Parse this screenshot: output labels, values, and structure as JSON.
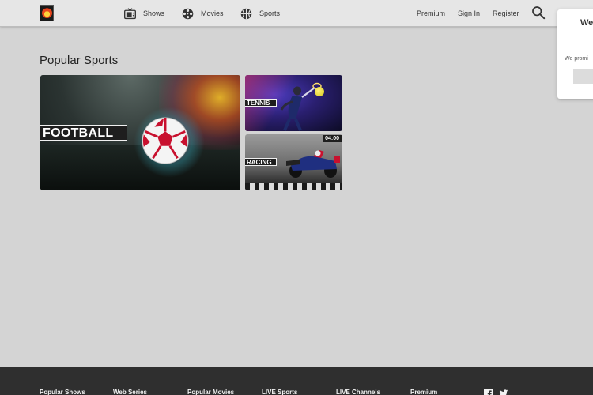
{
  "header": {
    "nav": [
      {
        "label": "Shows",
        "icon": "tv-icon"
      },
      {
        "label": "Movies",
        "icon": "film-reel-icon"
      },
      {
        "label": "Sports",
        "icon": "ball-icon"
      }
    ],
    "links": {
      "premium": "Premium",
      "sign_in": "Sign In",
      "register": "Register"
    },
    "search_icon": "search-icon"
  },
  "welcome_popup": {
    "title": "We",
    "text": "We promi"
  },
  "main": {
    "section_title": "Popular Sports",
    "tiles": [
      {
        "label": "FOOTBALL"
      },
      {
        "label": "TENNIS"
      },
      {
        "label": "RACING",
        "duration": "04:00"
      }
    ]
  },
  "footer": {
    "links": [
      "Popular Shows",
      "Web Series",
      "Popular Movies",
      "LIVE Channels",
      "LIVE Sports",
      "Premium"
    ],
    "social": [
      "facebook-icon",
      "twitter-icon"
    ]
  },
  "colors": {
    "background": "#d4d4d4",
    "header": "#e6e6e6",
    "footer": "#2f2f2f"
  }
}
